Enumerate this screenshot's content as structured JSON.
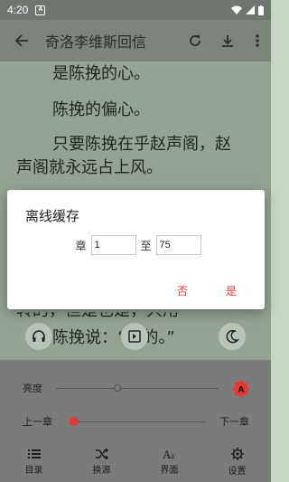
{
  "status_bar": {
    "time": "4:20",
    "notification_glyph": "A"
  },
  "app_bar": {
    "title": "奇洛李维斯回信"
  },
  "reader": {
    "lines": [
      "是陈挽的心。",
      "陈挽的偏心。",
      "只要陈挽在乎赵声阁，赵",
      "声阁就永远占上风。",
      "陈挽说：“是的。”"
    ],
    "partial_line": "转的，但是也是，只用"
  },
  "panel": {
    "brightness_label": "亮度",
    "prev_chapter": "上一章",
    "next_chapter": "下一章"
  },
  "nav": [
    {
      "label": "目录",
      "icon": "toc-icon"
    },
    {
      "label": "换源",
      "icon": "shuffle-icon"
    },
    {
      "label": "界面",
      "icon": "font-icon"
    },
    {
      "label": "设置",
      "icon": "gear-icon"
    }
  ],
  "dialog": {
    "title": "离线缓存",
    "from_label": "章",
    "from_value": "1",
    "to_label": "至",
    "to_value": "75",
    "cancel_label": "否",
    "confirm_label": "是"
  },
  "colors": {
    "accent": "#e53935"
  }
}
